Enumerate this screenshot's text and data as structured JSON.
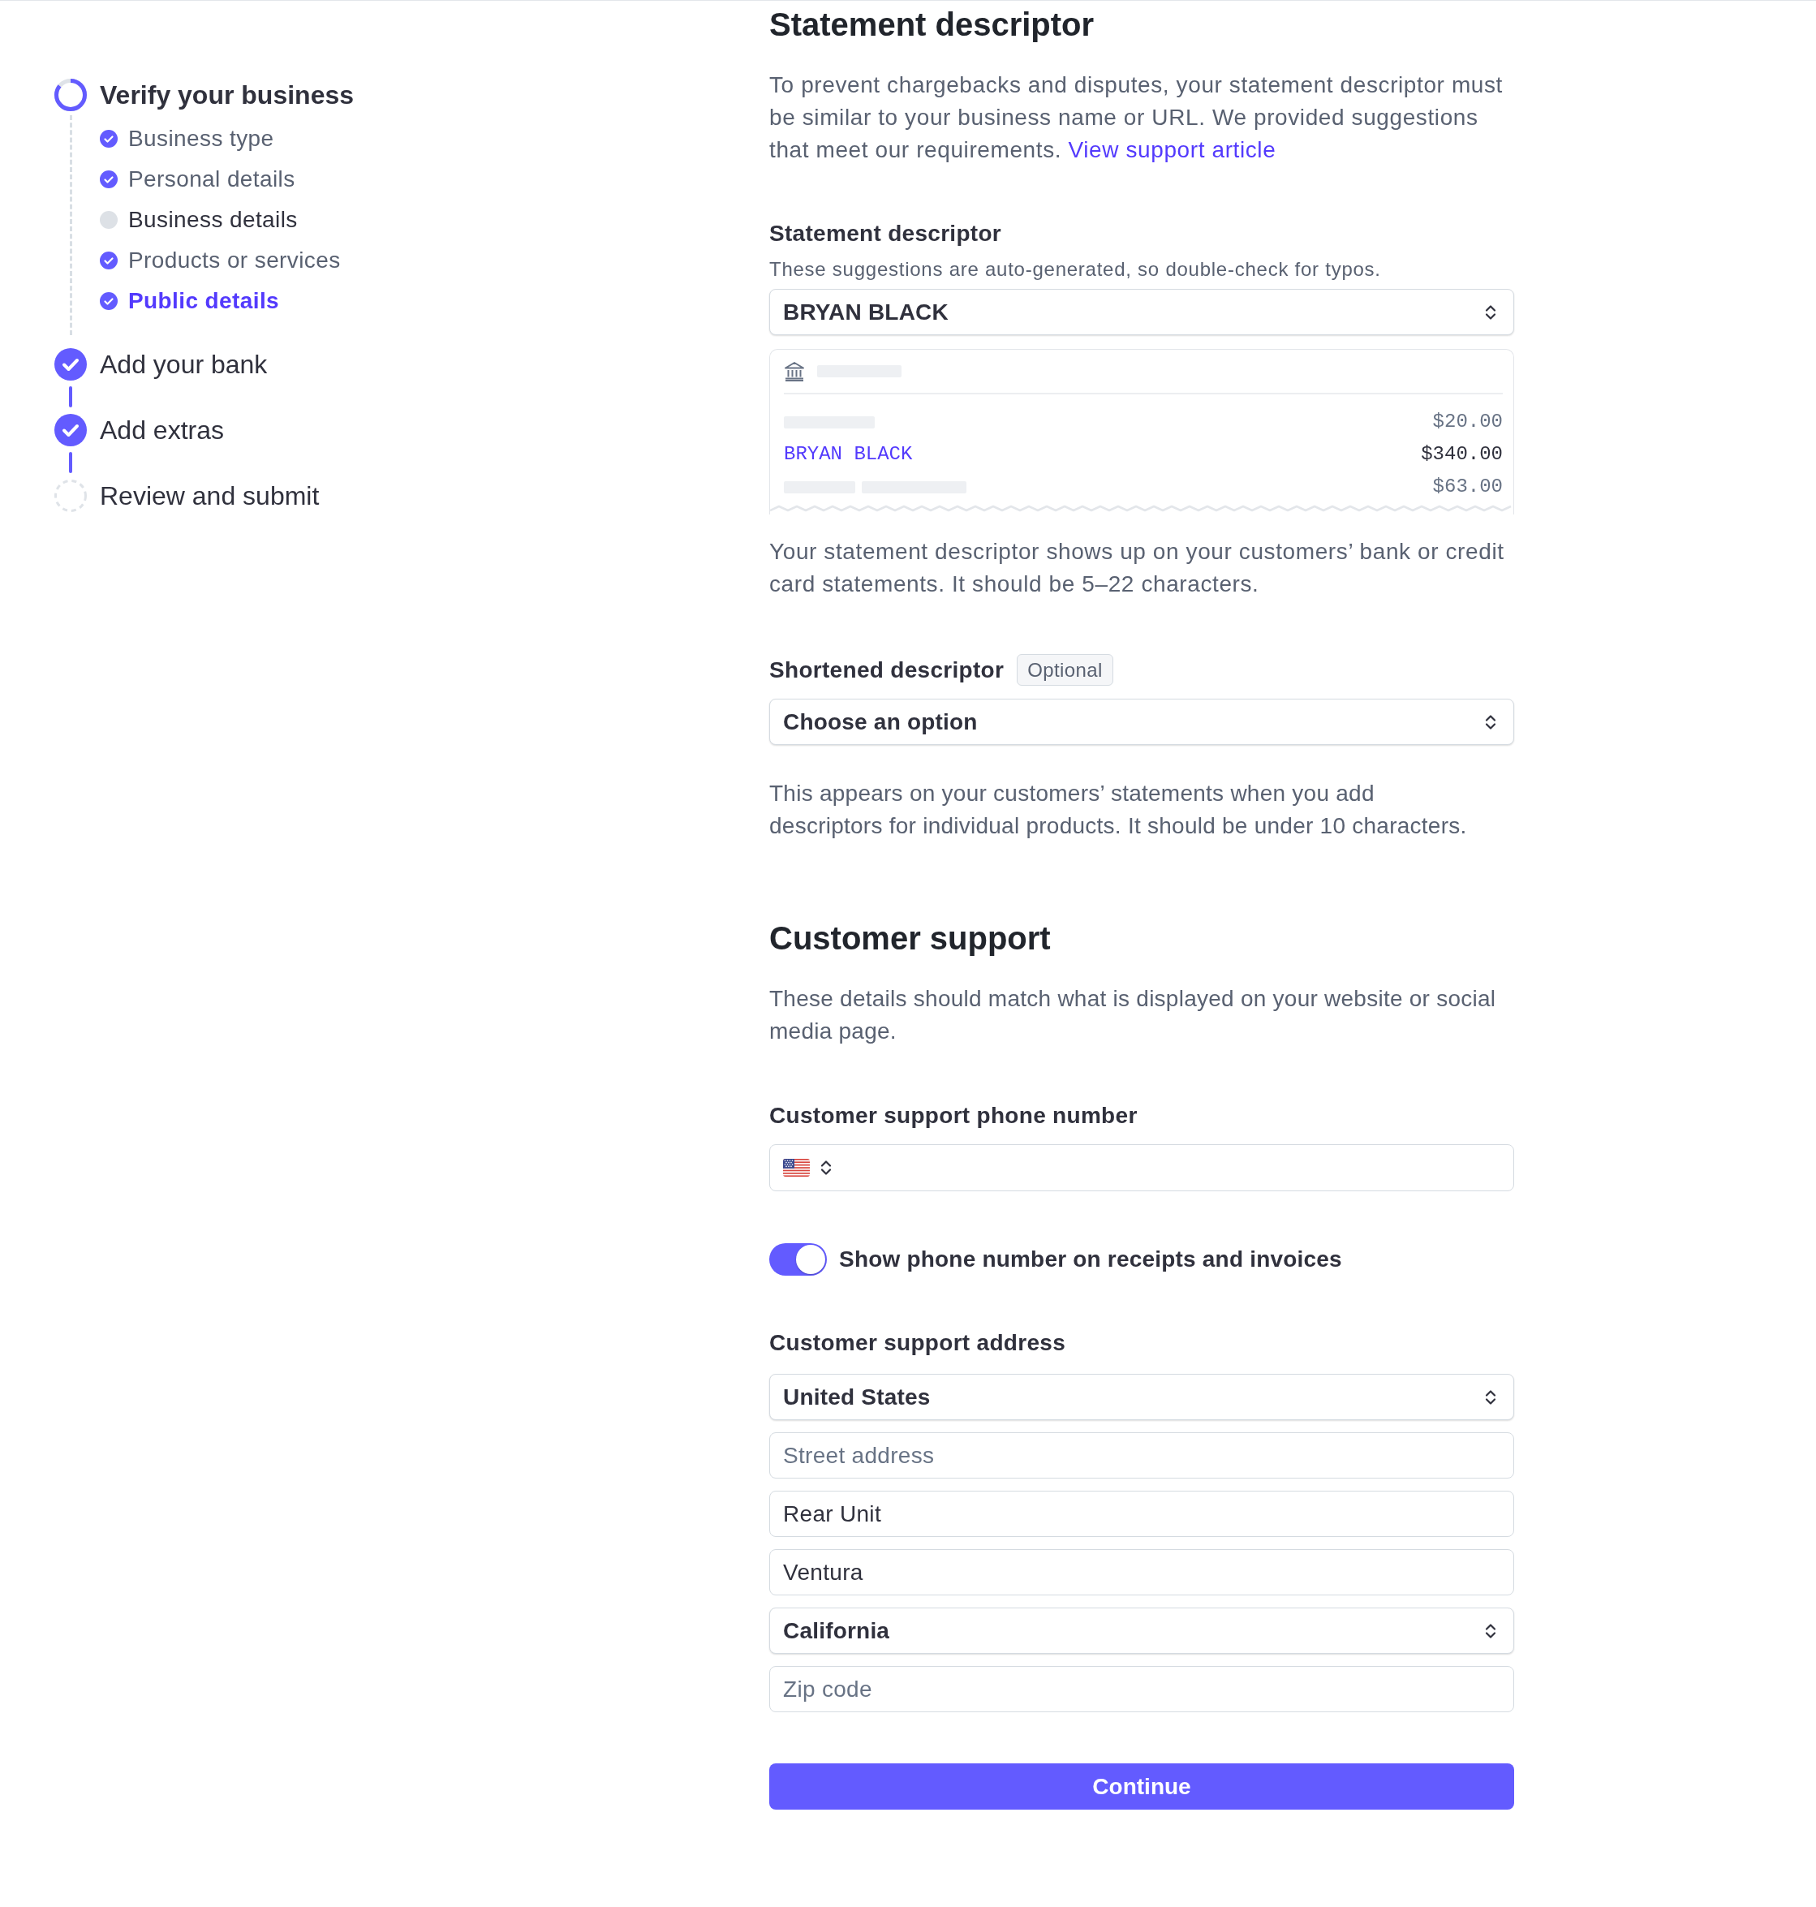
{
  "progress": {
    "steps": [
      {
        "label": "Verify your business",
        "complete": false,
        "selected": true,
        "children": [
          {
            "label": "Business type",
            "complete": true,
            "selected": false
          },
          {
            "label": "Personal details",
            "complete": true,
            "selected": false
          },
          {
            "label": "Business details",
            "complete": false,
            "selected": false
          },
          {
            "label": "Products or services",
            "complete": true,
            "selected": false
          },
          {
            "label": "Public details",
            "complete": true,
            "selected": true
          }
        ]
      },
      {
        "label": "Add your bank",
        "complete": true,
        "selected": false
      },
      {
        "label": "Add extras",
        "complete": true,
        "selected": false
      },
      {
        "label": "Review and submit",
        "complete": false,
        "selected": false
      }
    ]
  },
  "statement_descriptor": {
    "title": "Statement descriptor",
    "intro": "To prevent chargebacks and disputes, your statement descriptor must be similar to your business name or URL. We provided suggestions that meet our requirements.",
    "link": "View support article",
    "field": {
      "label": "Statement descriptor",
      "hint": "These suggestions are auto-generated, so double-check for typos.",
      "value": "BRYAN BLACK"
    },
    "preview": {
      "rows": [
        {
          "kind": "redacted",
          "amount": "$20.00"
        },
        {
          "kind": "descriptor",
          "text": "BRYAN BLACK",
          "amount": "$340.00"
        },
        {
          "kind": "redacted",
          "amount": "$63.00"
        }
      ]
    },
    "note": "Your statement descriptor shows up on your customers’ bank or credit card statements. It should be 5–22 characters.",
    "short_field": {
      "label": "Shortened descriptor",
      "badge": "Optional",
      "value": "Choose an option"
    },
    "short_note": "This appears on your customers’ statements when you add descriptors for individual products. It should be under 10 characters."
  },
  "customer_support": {
    "title": "Customer support",
    "intro": "These details should match what is displayed on your website or social media page.",
    "phone": {
      "label": "Customer support phone number"
    },
    "show_phone": {
      "label": "Show phone number on receipts and invoices",
      "on": true
    },
    "address": {
      "label": "Customer support address",
      "fields": [
        {
          "kind": "select",
          "value": "United States"
        },
        {
          "kind": "input",
          "placeholder": "Street address"
        },
        {
          "kind": "input",
          "value": "Rear Unit"
        },
        {
          "kind": "input",
          "value": "Ventura"
        },
        {
          "kind": "select",
          "value": "California"
        },
        {
          "kind": "input",
          "placeholder": "Zip code"
        }
      ]
    }
  },
  "continue_button": "Continue"
}
